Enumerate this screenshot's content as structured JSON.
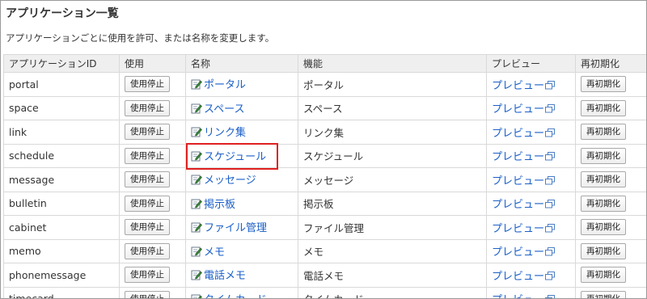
{
  "page": {
    "title": "アプリケーション一覧",
    "description": "アプリケーションごとに使用を許可、または名称を変更します。"
  },
  "table": {
    "headers": [
      "アプリケーションID",
      "使用",
      "名称",
      "機能",
      "プレビュー",
      "再初期化"
    ],
    "rows": [
      {
        "id": "portal",
        "use": "使用停止",
        "name": "ポータル",
        "func": "ポータル",
        "preview": "プレビュー",
        "reinit": "再初期化"
      },
      {
        "id": "space",
        "use": "使用停止",
        "name": "スペース",
        "func": "スペース",
        "preview": "プレビュー",
        "reinit": "再初期化"
      },
      {
        "id": "link",
        "use": "使用停止",
        "name": "リンク集",
        "func": "リンク集",
        "preview": "プレビュー",
        "reinit": "再初期化"
      },
      {
        "id": "schedule",
        "use": "使用停止",
        "name": "スケジュール",
        "func": "スケジュール",
        "preview": "プレビュー",
        "reinit": "再初期化"
      },
      {
        "id": "message",
        "use": "使用停止",
        "name": "メッセージ",
        "func": "メッセージ",
        "preview": "プレビュー",
        "reinit": "再初期化"
      },
      {
        "id": "bulletin",
        "use": "使用停止",
        "name": "掲示板",
        "func": "掲示板",
        "preview": "プレビュー",
        "reinit": "再初期化"
      },
      {
        "id": "cabinet",
        "use": "使用停止",
        "name": "ファイル管理",
        "func": "ファイル管理",
        "preview": "プレビュー",
        "reinit": "再初期化"
      },
      {
        "id": "memo",
        "use": "使用停止",
        "name": "メモ",
        "func": "メモ",
        "preview": "プレビュー",
        "reinit": "再初期化"
      },
      {
        "id": "phonemessage",
        "use": "使用停止",
        "name": "電話メモ",
        "func": "電話メモ",
        "preview": "プレビュー",
        "reinit": "再初期化"
      },
      {
        "id": "timecard",
        "use": "使用停止",
        "name": "タイムカード",
        "func": "タイムカード",
        "preview": "プレビュー",
        "reinit": "再初期化"
      }
    ]
  },
  "colors": {
    "link": "#1a5fc8",
    "highlight": "#e02020",
    "header_bg": "#efefef"
  },
  "icons": {
    "name_edit": "edit-icon",
    "preview_window": "new-window-icon"
  }
}
